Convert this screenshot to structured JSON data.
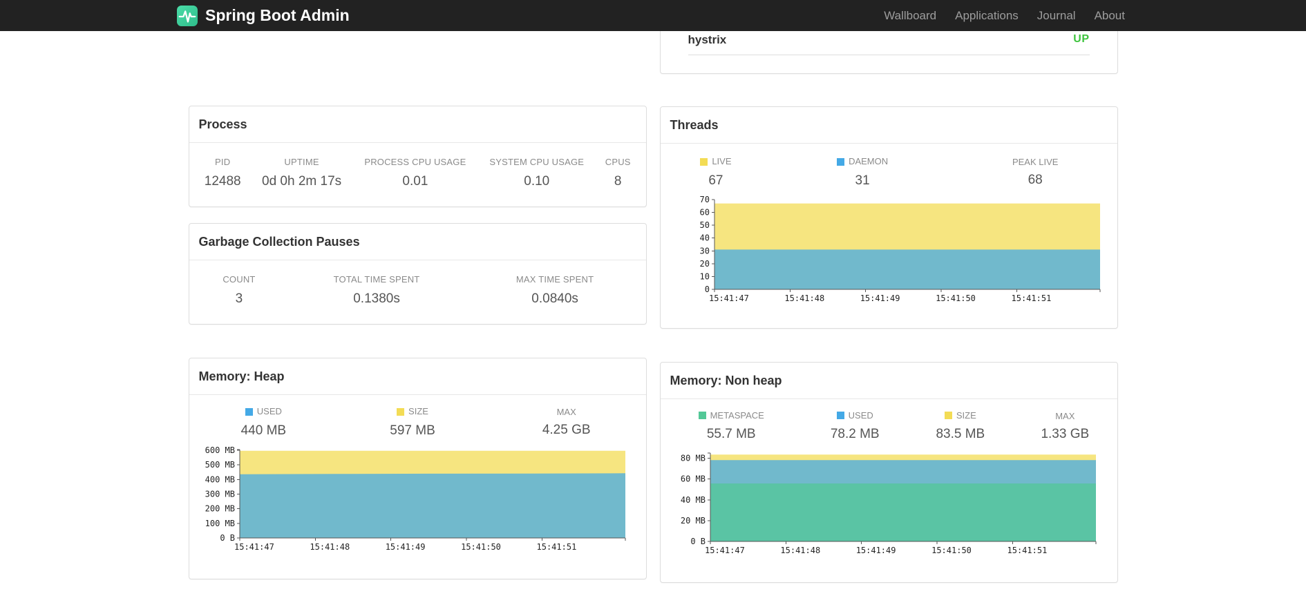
{
  "navbar": {
    "brand": "Spring Boot Admin",
    "links": [
      {
        "label": "Wallboard"
      },
      {
        "label": "Applications"
      },
      {
        "label": "Journal"
      },
      {
        "label": "About"
      }
    ]
  },
  "application_row": {
    "name": "hystrix",
    "status": "UP",
    "status_color": "#3ec43e"
  },
  "panels": {
    "process": {
      "title": "Process",
      "metrics": [
        {
          "label": "PID",
          "value": "12488"
        },
        {
          "label": "UPTIME",
          "value": "0d 0h 2m 17s"
        },
        {
          "label": "PROCESS CPU USAGE",
          "value": "0.01"
        },
        {
          "label": "SYSTEM CPU USAGE",
          "value": "0.10"
        },
        {
          "label": "CPUS",
          "value": "8"
        }
      ]
    },
    "gc": {
      "title": "Garbage Collection Pauses",
      "metrics": [
        {
          "label": "COUNT",
          "value": "3"
        },
        {
          "label": "TOTAL TIME SPENT",
          "value": "0.1380s"
        },
        {
          "label": "MAX TIME SPENT",
          "value": "0.0840s"
        }
      ]
    },
    "threads": {
      "title": "Threads"
    },
    "heap": {
      "title": "Memory: Heap"
    },
    "nonheap": {
      "title": "Memory: Non heap"
    }
  },
  "chart_data": [
    {
      "id": "threads",
      "type": "area",
      "title": "Threads",
      "legend_position": "top",
      "grid": false,
      "legend": [
        {
          "label": "LIVE",
          "value": "67",
          "color": "#f3dc55"
        },
        {
          "label": "DAEMON",
          "value": "31",
          "color": "#44a9e6"
        },
        {
          "label": "PEAK LIVE",
          "value": "68"
        }
      ],
      "x": [
        "15:41:47",
        "15:41:48",
        "15:41:49",
        "15:41:50",
        "15:41:51"
      ],
      "ylim": [
        0,
        70
      ],
      "yticks": [
        {
          "v": 0,
          "label": "0"
        },
        {
          "v": 10,
          "label": "10"
        },
        {
          "v": 20,
          "label": "20"
        },
        {
          "v": 30,
          "label": "30"
        },
        {
          "v": 40,
          "label": "40"
        },
        {
          "v": 50,
          "label": "50"
        },
        {
          "v": 60,
          "label": "60"
        },
        {
          "v": 70,
          "label": "70"
        }
      ],
      "series": [
        {
          "name": "LIVE",
          "color": "#f3dc55",
          "values": [
            67,
            67,
            67,
            67,
            67
          ]
        },
        {
          "name": "DAEMON",
          "color": "#44a9e6",
          "values": [
            31,
            31,
            31,
            31,
            31
          ]
        }
      ]
    },
    {
      "id": "memory-heap",
      "type": "area",
      "title": "Memory: Heap",
      "legend_position": "top",
      "grid": false,
      "legend": [
        {
          "label": "USED",
          "value": "440 MB",
          "color": "#44a9e6"
        },
        {
          "label": "SIZE",
          "value": "597 MB",
          "color": "#f3dc55"
        },
        {
          "label": "MAX",
          "value": "4.25 GB"
        }
      ],
      "x": [
        "15:41:47",
        "15:41:48",
        "15:41:49",
        "15:41:50",
        "15:41:51"
      ],
      "ylim": [
        0,
        605
      ],
      "yticks": [
        {
          "v": 0,
          "label": "0 B"
        },
        {
          "v": 100,
          "label": "100 MB"
        },
        {
          "v": 200,
          "label": "200 MB"
        },
        {
          "v": 300,
          "label": "300 MB"
        },
        {
          "v": 400,
          "label": "400 MB"
        },
        {
          "v": 500,
          "label": "500 MB"
        },
        {
          "v": 600,
          "label": "600 MB"
        }
      ],
      "series": [
        {
          "name": "SIZE",
          "color": "#f3dc55",
          "values": [
            597,
            597,
            597,
            597,
            597
          ]
        },
        {
          "name": "USED",
          "color": "#44a9e6",
          "values": [
            436,
            438,
            440,
            441,
            443
          ]
        }
      ]
    },
    {
      "id": "memory-nonheap",
      "type": "area",
      "title": "Memory: Non heap",
      "legend_position": "top",
      "grid": false,
      "legend": [
        {
          "label": "METASPACE",
          "value": "55.7 MB",
          "color": "#53c897"
        },
        {
          "label": "USED",
          "value": "78.2 MB",
          "color": "#44a9e6"
        },
        {
          "label": "SIZE",
          "value": "83.5 MB",
          "color": "#f3dc55"
        },
        {
          "label": "MAX",
          "value": "1.33 GB"
        }
      ],
      "x": [
        "15:41:47",
        "15:41:48",
        "15:41:49",
        "15:41:50",
        "15:41:51"
      ],
      "ylim": [
        0,
        85
      ],
      "yticks": [
        {
          "v": 0,
          "label": "0 B"
        },
        {
          "v": 20,
          "label": "20 MB"
        },
        {
          "v": 40,
          "label": "40 MB"
        },
        {
          "v": 60,
          "label": "60 MB"
        },
        {
          "v": 80,
          "label": "80 MB"
        }
      ],
      "series": [
        {
          "name": "SIZE",
          "color": "#f3dc55",
          "values": [
            83.5,
            83.5,
            83.5,
            83.5,
            83.5
          ]
        },
        {
          "name": "USED",
          "color": "#44a9e6",
          "values": [
            78.2,
            78.2,
            78.2,
            78.2,
            78.2
          ]
        },
        {
          "name": "METASPACE",
          "color": "#53c897",
          "values": [
            55.7,
            55.7,
            55.7,
            55.7,
            55.7
          ]
        }
      ]
    }
  ]
}
